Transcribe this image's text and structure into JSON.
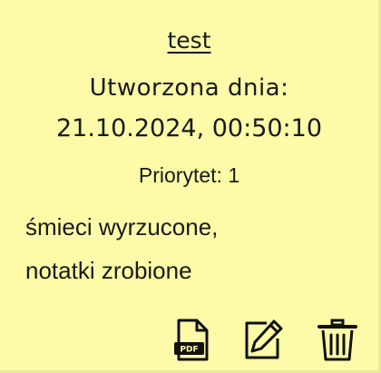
{
  "note": {
    "title": "test",
    "created_label": "Utworzona dnia:",
    "created_date": "21.10.2024, 00:50:10",
    "priority_label": "Priorytet:",
    "priority_value": "1",
    "content_lines": [
      "śmieci wyrzucone,",
      "notatki zrobione"
    ]
  },
  "actions": {
    "pdf_icon": "pdf-file-icon",
    "pdf_badge": "PDF",
    "edit_icon": "edit-icon",
    "delete_icon": "trash-icon"
  },
  "colors": {
    "note_background": "#fdfaa8",
    "text": "#1a1a1a"
  }
}
